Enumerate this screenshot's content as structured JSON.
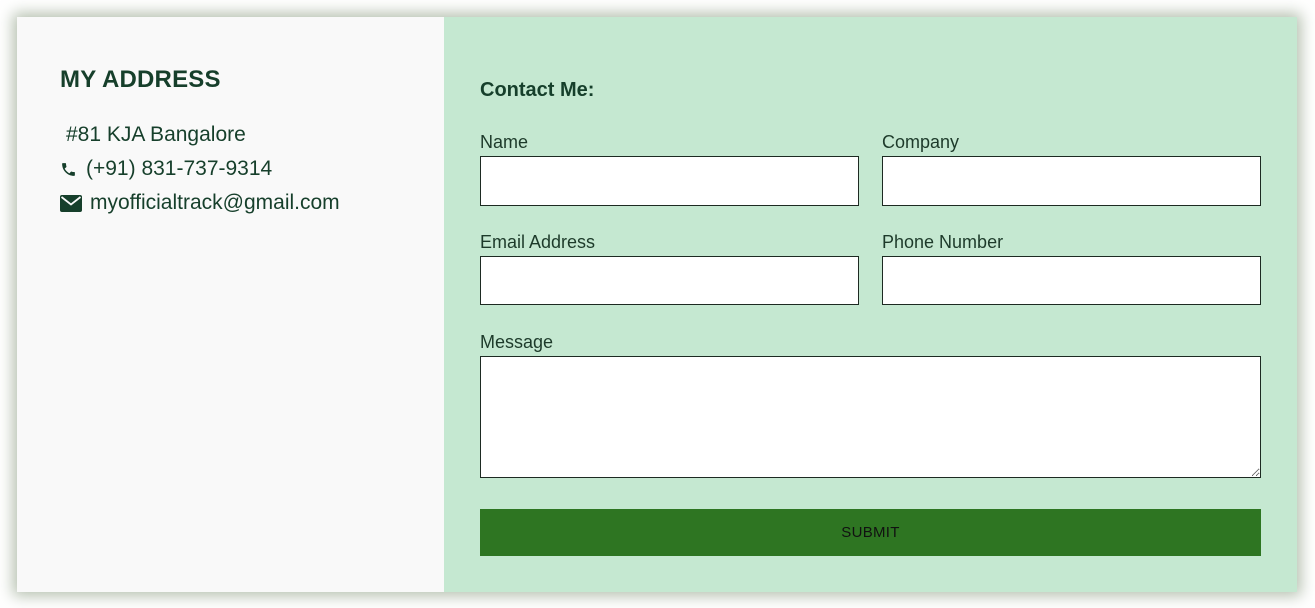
{
  "address": {
    "heading": "MY ADDRESS",
    "street": "#81 KJA Bangalore",
    "phone": "(+91) 831-737-9314",
    "email": "myofficialtrack@gmail.com",
    "phone_icon": "phone-icon",
    "email_icon": "envelope-icon"
  },
  "contact_form": {
    "title": "Contact Me:",
    "fields": {
      "name": {
        "label": "Name",
        "value": "",
        "placeholder": ""
      },
      "company": {
        "label": "Company",
        "value": "",
        "placeholder": ""
      },
      "email": {
        "label": "Email Address",
        "value": "",
        "placeholder": ""
      },
      "phone": {
        "label": "Phone Number",
        "value": "",
        "placeholder": ""
      },
      "message": {
        "label": "Message",
        "value": "",
        "placeholder": ""
      }
    },
    "submit_label": "SUBMIT"
  },
  "colors": {
    "left_panel_bg": "#f9f9f9",
    "right_panel_bg": "#c5e8d1",
    "text_dark_green": "#163f2b",
    "submit_bg": "#2e7522"
  }
}
